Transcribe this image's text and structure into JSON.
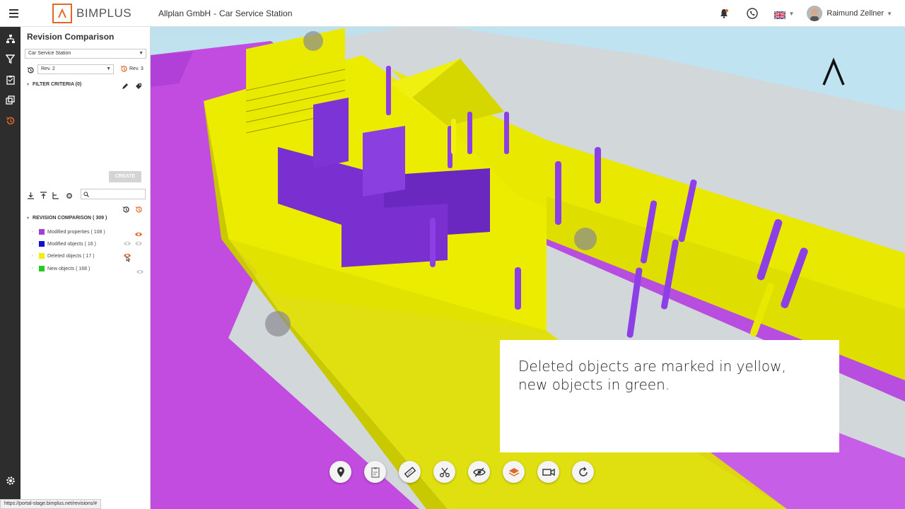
{
  "header": {
    "brand": "BIMPLUS",
    "company": "Allplan GmbH",
    "separator": "-",
    "project": "Car Service Station",
    "user": "Raimund Zellner"
  },
  "panel": {
    "title": "Revision Comparison",
    "project_select": "Car Service Station",
    "revision_from": "Rev. 2",
    "revision_to": "Rev. 3",
    "filter_criteria": "FILTER CRITERIA (0)",
    "create_label": "CREATE",
    "search_placeholder": ""
  },
  "tree": {
    "root_label": "REVISION COMPARISON",
    "root_count": "( 309 )",
    "items": [
      {
        "label": "Modified properties",
        "count": "( 108 )",
        "color": "#a23fd8"
      },
      {
        "label": "Modified objects",
        "count": "( 16 )",
        "color": "#1010d0"
      },
      {
        "label": "Deleted objects",
        "count": "( 17 )",
        "color": "#f2f000"
      },
      {
        "label": "New objects",
        "count": "( 168 )",
        "color": "#22cc22"
      }
    ]
  },
  "caption": {
    "line1": "Deleted objects are marked in yellow,",
    "line2": "new objects in green."
  },
  "status_url": "https://portal-stage.bimplus.net/revisions/#",
  "colors": {
    "accent": "#e2672a",
    "magenta": "#c13ee3",
    "yellow": "#e8e800",
    "purple": "#7a2fd0"
  }
}
